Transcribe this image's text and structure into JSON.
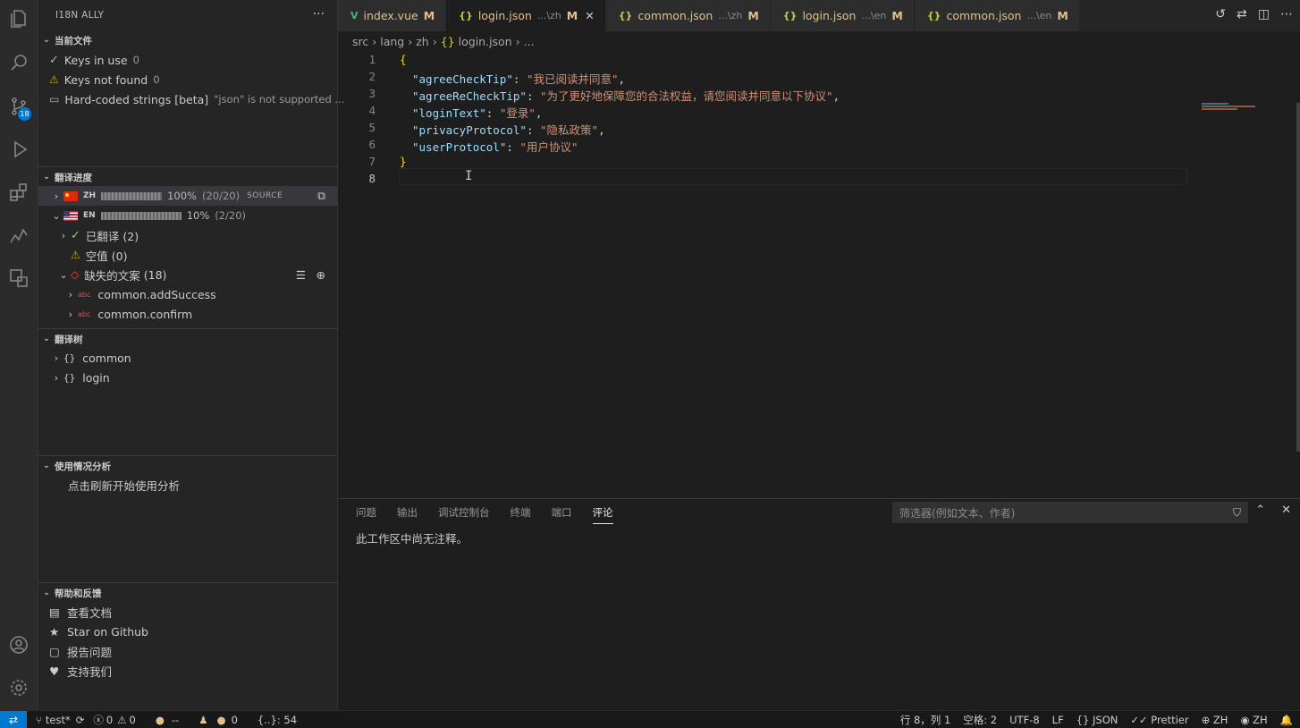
{
  "sidebar": {
    "title": "I18N ALLY",
    "more": "···",
    "current_file": {
      "header": "当前文件",
      "keys_in_use": "Keys in use",
      "keys_in_use_count": "0",
      "keys_not_found": "Keys not found",
      "keys_not_found_count": "0",
      "hardcoded": "Hard-coded strings [beta]",
      "hardcoded_note": "\"json\" is not supported ..."
    },
    "progress": {
      "header": "翻译进度",
      "zh_code": "ZH",
      "zh_percent": "100%",
      "zh_ratio": "(20/20)",
      "zh_source": "SOURCE",
      "en_code": "EN",
      "en_percent": "10%",
      "en_ratio": "(2/20)",
      "translated": "已翻译 (2)",
      "empty": "空值 (0)",
      "missing": "缺失的文案",
      "missing_count": "(18)",
      "missing_items": [
        "common.addSuccess",
        "common.confirm"
      ]
    },
    "tree": {
      "header": "翻译树",
      "items": [
        "common",
        "login"
      ]
    },
    "usage": {
      "header": "使用情况分析",
      "hint": "点击刷新开始使用分析"
    },
    "help": {
      "header": "帮助和反馈",
      "items": [
        "查看文档",
        "Star on Github",
        "报告问题",
        "支持我们"
      ]
    }
  },
  "activity": {
    "scm_badge": "18"
  },
  "tabs": [
    {
      "icon": "V",
      "name": "index.vue",
      "desc": "",
      "mod": "M"
    },
    {
      "icon": "{}",
      "name": "login.json",
      "desc": "...\\zh",
      "mod": "M"
    },
    {
      "icon": "{}",
      "name": "common.json",
      "desc": "...\\zh",
      "mod": "M"
    },
    {
      "icon": "{}",
      "name": "login.json",
      "desc": "...\\en",
      "mod": "M"
    },
    {
      "icon": "{}",
      "name": "common.json",
      "desc": "...\\en",
      "mod": "M"
    }
  ],
  "breadcrumb": [
    "src",
    "lang",
    "zh",
    "login.json",
    "..."
  ],
  "editor": {
    "line_numbers": [
      "1",
      "2",
      "3",
      "4",
      "5",
      "6",
      "7",
      "8"
    ],
    "lines": [
      {
        "open": "{"
      },
      {
        "key": "\"agreeCheckTip\"",
        "val": "\"我已阅读并同意\"",
        "end": ","
      },
      {
        "key": "\"agreeReCheckTip\"",
        "val": "\"为了更好地保障您的合法权益，请您阅读并同意以下协议\"",
        "end": ","
      },
      {
        "key": "\"loginText\"",
        "val": "\"登录\"",
        "end": ","
      },
      {
        "key": "\"privacyProtocol\"",
        "val": "\"隐私政策\"",
        "end": ","
      },
      {
        "key": "\"userProtocol\"",
        "val": "\"用户协议\"",
        "end": ""
      },
      {
        "open": "}"
      }
    ]
  },
  "panel": {
    "tabs": [
      "问题",
      "输出",
      "调试控制台",
      "终端",
      "端口",
      "评论"
    ],
    "filter_placeholder": "筛选器(例如文本、作者)",
    "message": "此工作区中尚无注释。"
  },
  "status": {
    "branch": "test*",
    "errors": "0",
    "warnings": "0",
    "dashes": "--",
    "count": "0",
    "json_info": "{..}: 54",
    "position": "行 8，列 1",
    "spaces": "空格: 2",
    "encoding": "UTF-8",
    "eol": "LF",
    "language": "JSON",
    "formatter": "Prettier",
    "locale1": "ZH",
    "locale2": "ZH"
  }
}
